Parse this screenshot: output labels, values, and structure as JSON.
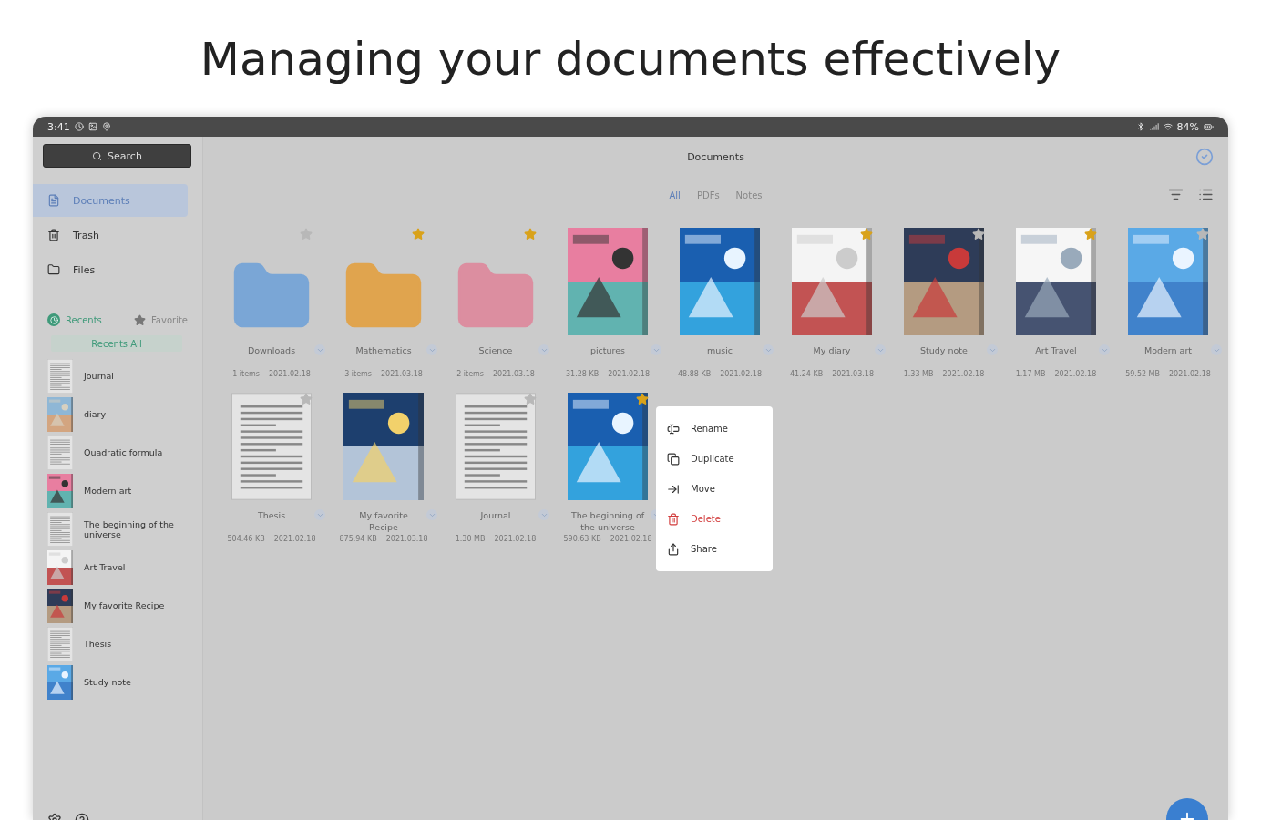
{
  "headline": "Managing your documents effectively",
  "status_bar": {
    "time": "3:41",
    "battery": "84%"
  },
  "sidebar": {
    "search": "Search",
    "nav": [
      {
        "label": "Documents",
        "selected": true
      },
      {
        "label": "Trash",
        "selected": false
      },
      {
        "label": "Files",
        "selected": false
      }
    ],
    "tabs": [
      {
        "label": "Recents",
        "selected": true
      },
      {
        "label": "Favorite",
        "selected": false
      }
    ],
    "recents_button": "Recents All",
    "recents": [
      {
        "name": "Journal",
        "kind": "page"
      },
      {
        "name": "diary",
        "kind": "picture"
      },
      {
        "name": "Quadratic formula",
        "kind": "page"
      },
      {
        "name": "Modern art",
        "kind": "picture"
      },
      {
        "name": "The beginning of the universe",
        "kind": "page"
      },
      {
        "name": "Art Travel",
        "kind": "picture"
      },
      {
        "name": "My favorite Recipe",
        "kind": "picture"
      },
      {
        "name": "Thesis",
        "kind": "page"
      },
      {
        "name": "Study note",
        "kind": "picture"
      }
    ]
  },
  "main": {
    "title": "Documents",
    "filters": [
      {
        "label": "All",
        "selected": true
      },
      {
        "label": "PDFs",
        "selected": false
      },
      {
        "label": "Notes",
        "selected": false
      }
    ],
    "items": [
      {
        "kind": "folder",
        "color": "#7aa6d6",
        "name": "Downloads",
        "size": "1 items",
        "date": "2021.02.18",
        "starred": false
      },
      {
        "kind": "folder",
        "color": "#e0a44e",
        "name": "Mathematics",
        "size": "3 items",
        "date": "2021.03.18",
        "starred": true
      },
      {
        "kind": "folder",
        "color": "#dc8ea0",
        "name": "Science",
        "size": "2 items",
        "date": "2021.03.18",
        "starred": true
      },
      {
        "kind": "cover",
        "name": "pictures",
        "size": "31.28 KB",
        "date": "2021.02.18"
      },
      {
        "kind": "cover",
        "name": "music",
        "size": "48.88 KB",
        "date": "2021.02.18"
      },
      {
        "kind": "cover",
        "name": "My diary",
        "size": "41.24 KB",
        "date": "2021.03.18",
        "starred": true
      },
      {
        "kind": "cover",
        "name": "Study note",
        "size": "1.33 MB",
        "date": "2021.02.18",
        "starred": false
      },
      {
        "kind": "cover",
        "name": "Art Travel",
        "size": "1.17 MB",
        "date": "2021.02.18",
        "starred": true
      },
      {
        "kind": "cover",
        "name": "Modern art",
        "size": "59.52 MB",
        "date": "2021.02.18",
        "starred": false
      },
      {
        "kind": "page",
        "name": "Thesis",
        "size": "504.46 KB",
        "date": "2021.02.18",
        "starred": false
      },
      {
        "kind": "cover",
        "name": "My favorite Recipe",
        "size": "875.94 KB",
        "date": "2021.03.18"
      },
      {
        "kind": "page",
        "name": "Journal",
        "size": "1.30 MB",
        "date": "2021.02.18",
        "starred": false
      },
      {
        "kind": "cover",
        "name": "The beginning of the universe",
        "size": "590.63 KB",
        "date": "2021.02.18",
        "starred": true
      }
    ],
    "context_menu": [
      {
        "label": "Rename",
        "kind": "normal"
      },
      {
        "label": "Duplicate",
        "kind": "normal"
      },
      {
        "label": "Move",
        "kind": "normal"
      },
      {
        "label": "Delete",
        "kind": "danger"
      },
      {
        "label": "Share",
        "kind": "normal"
      }
    ]
  }
}
